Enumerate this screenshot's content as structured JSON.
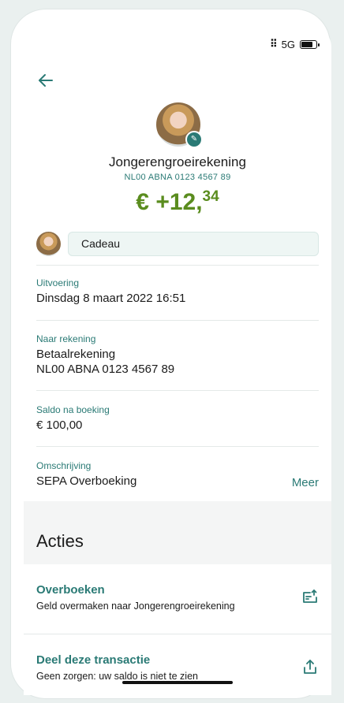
{
  "status": {
    "network": "5G"
  },
  "header": {
    "account_name": "Jongerengroeirekening",
    "account_iban": "NL00 ABNA 0123 4567 89",
    "amount_main": "€ +12,",
    "amount_cents": "34"
  },
  "note": {
    "value": "Cadeau"
  },
  "details": [
    {
      "label": "Uitvoering",
      "lines": [
        "Dinsdag 8 maart 2022 16:51"
      ]
    },
    {
      "label": "Naar rekening",
      "lines": [
        "Betaalrekening",
        "NL00 ABNA 0123 4567 89"
      ]
    },
    {
      "label": "Saldo na boeking",
      "lines": [
        "€ 100,00"
      ]
    },
    {
      "label": "Omschrijving",
      "lines": [
        "SEPA Overboeking"
      ]
    }
  ],
  "meer_label": "Meer",
  "acties": {
    "title": "Acties",
    "items": [
      {
        "title": "Overboeken",
        "subtitle": "Geld overmaken naar Jongerengroeirekening",
        "icon": "transfer-icon"
      },
      {
        "title": "Deel deze transactie",
        "subtitle": "Geen zorgen: uw saldo is niet te zien",
        "icon": "share-icon"
      }
    ]
  },
  "colors": {
    "accent": "#2a7a75",
    "amount": "#5a8c1e"
  }
}
